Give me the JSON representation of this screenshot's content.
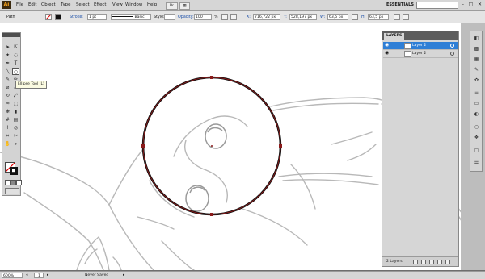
{
  "app": {
    "logo": "Ai",
    "workspace": "ESSENTIALS"
  },
  "menu": [
    "File",
    "Edit",
    "Object",
    "Type",
    "Select",
    "Effect",
    "View",
    "Window",
    "Help"
  ],
  "control_bar": {
    "selection_label": "Path",
    "stroke_label": "Stroke:",
    "stroke_value": "1 pt",
    "brush_value": "Basic",
    "style_label": "Style:",
    "opacity_label": "Opacity:",
    "opacity_value": "100",
    "opacity_unit": "%",
    "x_label": "X:",
    "x_value": "716,722 px",
    "y_label": "Y:",
    "y_value": "528,197 px",
    "w_label": "W:",
    "w_value": "63,5 px",
    "h_label": "H:",
    "h_value": "63,5 px"
  },
  "tooltip": "Ellipse Tool (L)",
  "tools": [
    "select-arrow",
    "direct-select-arrow",
    "magic-wand",
    "lasso",
    "pen",
    "type",
    "line",
    "ellipse",
    "paintbrush",
    "pencil",
    "blob-brush",
    "eraser",
    "rotate",
    "scale",
    "warp",
    "free-transform",
    "symbol-sprayer",
    "column-graph",
    "mesh",
    "gradient",
    "eyedropper",
    "blend",
    "slice",
    "scissors",
    "hand",
    "zoom"
  ],
  "layers_panel": {
    "title": "LAYERS",
    "layers": [
      {
        "name": "Layer 2",
        "selected": true
      },
      {
        "name": "Layer 2",
        "selected": false
      }
    ],
    "count": "2 Layers"
  },
  "status": {
    "zoom": "600%",
    "artboard": "1",
    "save_state": "Never Saved"
  },
  "colors": {
    "selection": "#2f7fd6",
    "artwork_stroke": "#8b1a1a",
    "sketch": "#b5b5b5"
  }
}
